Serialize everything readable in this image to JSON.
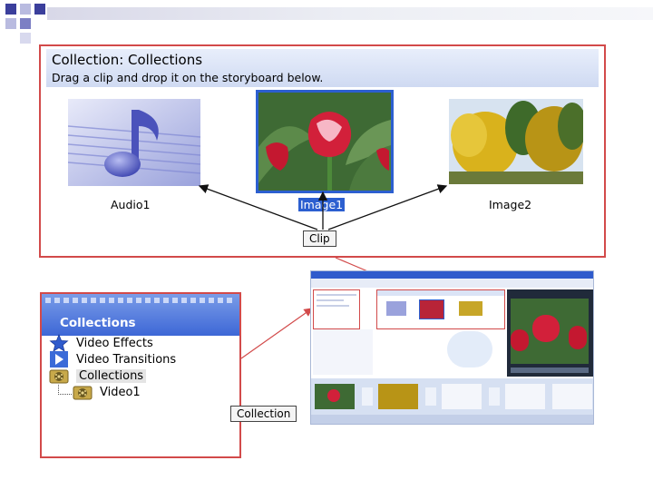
{
  "top_panel": {
    "title": "Collection: Collections",
    "subtitle": "Drag a clip and drop it on the storyboard below.",
    "clips": [
      {
        "label": "Audio1",
        "selected": false
      },
      {
        "label": "Image1",
        "selected": true
      },
      {
        "label": "Image2",
        "selected": false
      }
    ],
    "callout": "Clip"
  },
  "tree_panel": {
    "title": "Collections",
    "items": [
      {
        "label": "Video Effects",
        "icon": "star-icon"
      },
      {
        "label": "Video Transitions",
        "icon": "play-icon"
      },
      {
        "label": "Collections",
        "icon": "film-reel-icon",
        "selected": true
      },
      {
        "label": "Video1",
        "icon": "film-reel-icon"
      }
    ],
    "callout": "Collection"
  },
  "colors": {
    "accent_red": "#d24a4a",
    "header_blue": "#3d67d6",
    "selection_blue": "#2c5fd0"
  }
}
